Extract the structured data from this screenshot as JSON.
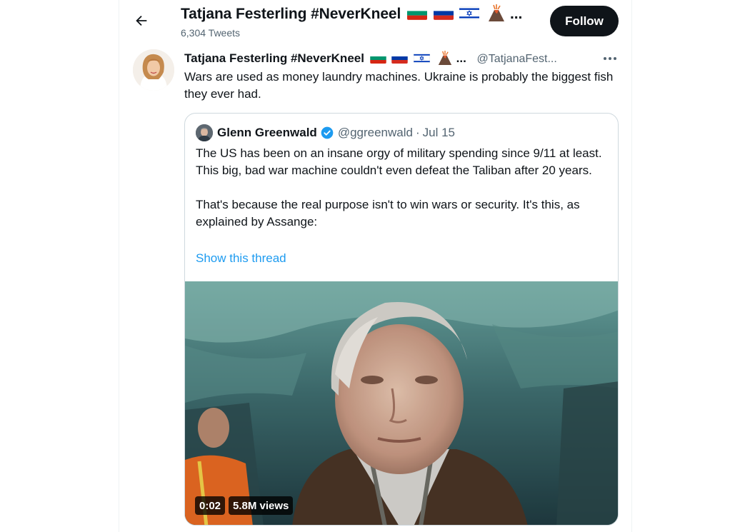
{
  "header": {
    "name": "Tatjana Festerling #NeverKneel",
    "name_suffix": "...",
    "tweet_count": "6,304 Tweets",
    "follow_label": "Follow"
  },
  "tweet": {
    "author_name": "Tatjana Festerling #NeverKneel",
    "author_suffix": "...",
    "author_handle": "@TatjanaFest...",
    "text": "Wars are used as money laundry machines. Ukraine is probably the biggest fish they ever had."
  },
  "quoted_tweet": {
    "author_name": "Glenn Greenwald",
    "author_handle": "@ggreenwald",
    "separator": "·",
    "date": "Jul 15",
    "paragraphs": [
      "The US has been on an insane orgy of military spending since 9/11 at least. This big, bad war machine couldn't even defeat the Taliban after 20 years.",
      "That's because the real purpose isn't to win wars or security. It's this, as explained by Assange:"
    ],
    "show_thread_label": "Show this thread",
    "video": {
      "duration": "0:02",
      "views": "5.8M views"
    }
  },
  "icons": {
    "back": "arrow-left-icon",
    "more": "more-horizontal-icon",
    "verified": "verified-badge-icon",
    "flags": [
      "flag-bulgaria",
      "flag-russia",
      "flag-israel",
      "volcano-emoji"
    ]
  },
  "colors": {
    "accent": "#1d9bf0",
    "text": "#0f1419",
    "secondary_text": "#536471",
    "border": "#cfd9de",
    "follow_bg": "#0f1419"
  }
}
